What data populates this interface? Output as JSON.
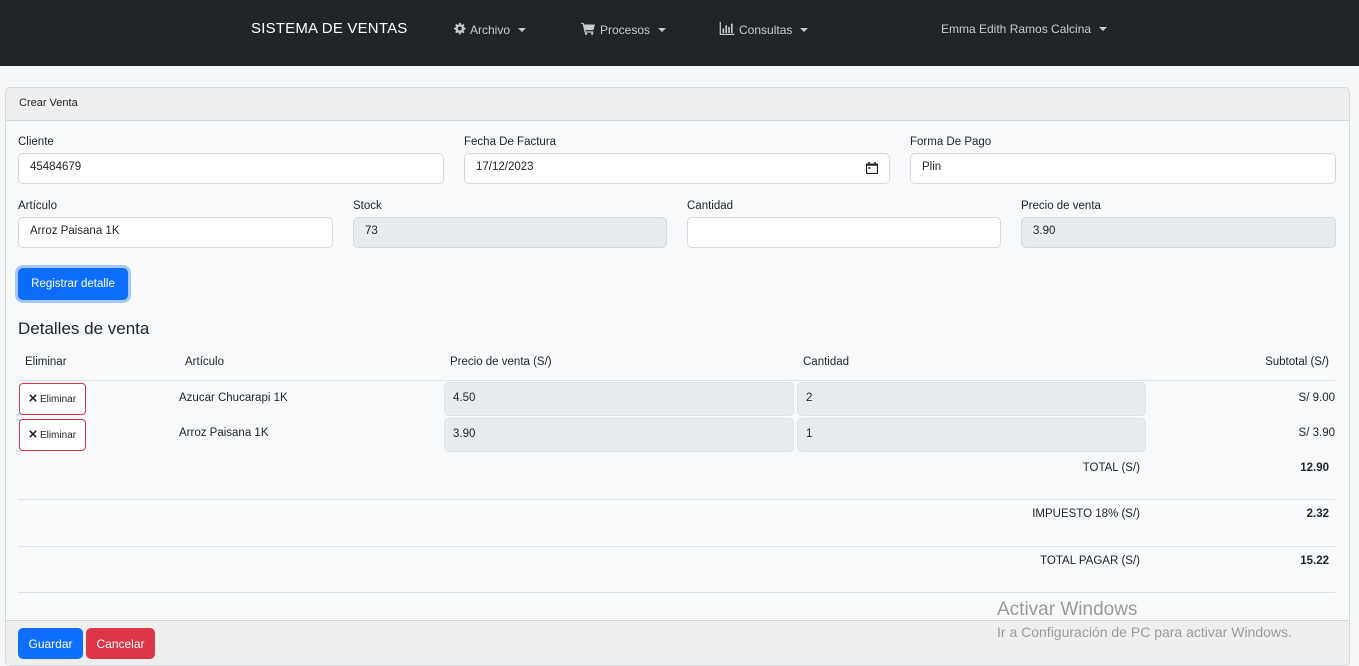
{
  "navbar": {
    "brand": "SISTEMA DE VENTAS",
    "items": [
      {
        "label": "Archivo",
        "icon": "gear-icon"
      },
      {
        "label": "Procesos",
        "icon": "cart-icon"
      },
      {
        "label": "Consultas",
        "icon": "chart-icon"
      }
    ],
    "user": "Emma Edith Ramos Calcina"
  },
  "card": {
    "header": "Crear Venta"
  },
  "form": {
    "cliente": {
      "label": "Cliente",
      "value": "45484679"
    },
    "fecha": {
      "label": "Fecha De Factura",
      "value": "17/12/2023"
    },
    "forma_pago": {
      "label": "Forma De Pago",
      "value": "Plin"
    },
    "articulo": {
      "label": "Artículo",
      "value": "Arroz Paisana 1K"
    },
    "stock": {
      "label": "Stock",
      "value": "73"
    },
    "cantidad": {
      "label": "Cantidad",
      "value": ""
    },
    "precio": {
      "label": "Precio de venta",
      "value": "3.90"
    },
    "registrar_label": "Registrar detalle"
  },
  "detalles": {
    "title": "Detalles de venta",
    "columns": [
      "Eliminar",
      "Artículo",
      "Precio de venta (S/)",
      "Cantidad",
      "Subtotal (S/)"
    ],
    "rows": [
      {
        "delete_label": "Eliminar",
        "articulo": "Azucar Chucarapi 1K",
        "precio": "4.50",
        "cantidad": "2",
        "subtotal": "S/ 9.00"
      },
      {
        "delete_label": "Eliminar",
        "articulo": "Arroz Paisana 1K",
        "precio": "3.90",
        "cantidad": "1",
        "subtotal": "S/ 3.90"
      }
    ],
    "totals": [
      {
        "label": "TOTAL (S/)",
        "value": "12.90"
      },
      {
        "label": "IMPUESTO 18% (S/)",
        "value": "2.32"
      },
      {
        "label": "TOTAL PAGAR (S/)",
        "value": "15.22"
      }
    ]
  },
  "footer": {
    "save_label": "Guardar",
    "cancel_label": "Cancelar"
  },
  "watermark": {
    "line1": "Activar Windows",
    "line2": "Ir a Configuración de PC para activar Windows."
  },
  "colors": {
    "primary": "#0d6efd",
    "danger": "#dc3545",
    "navbar": "#212529"
  }
}
